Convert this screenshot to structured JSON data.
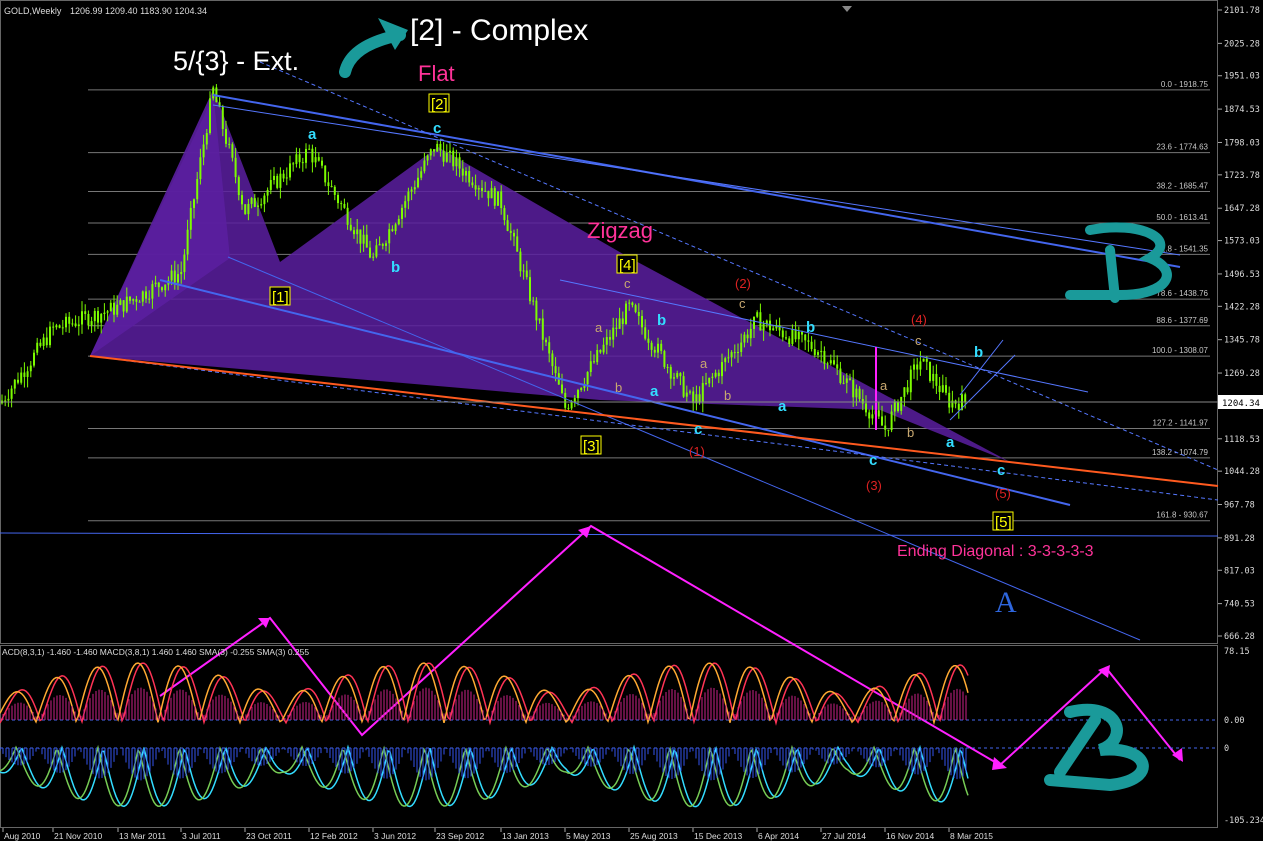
{
  "header": {
    "symbol": "GOLD,Weekly",
    "ohlc": "1206.99 1209.40 1183.90 1204.34"
  },
  "price_axis": {
    "labels": [
      "2101.78",
      "2025.28",
      "1951.03",
      "1874.53",
      "1798.03",
      "1723.78",
      "1647.28",
      "1573.03",
      "1496.53",
      "1422.28",
      "1345.78",
      "1269.28",
      "1204.34",
      "1118.53",
      "1044.28",
      "967.78",
      "891.28",
      "817.03",
      "740.53",
      "666.28"
    ],
    "current_price": "1204.34"
  },
  "macd_axis": {
    "labels": [
      "78.15",
      "0.00",
      "0",
      "-105.234"
    ]
  },
  "macd_header": "ACD(8,3,1) -1.460 -1.460  MACD(3,8,1) 1.460 1.460  SMA(3) -0.255  SMA(3) 0.255",
  "date_axis": [
    "Aug 2010",
    "21 Nov 2010",
    "13 Mar 2011",
    "3 Jul 2011",
    "23 Oct 2011",
    "12 Feb 2012",
    "3 Jun 2012",
    "23 Sep 2012",
    "13 Jan 2013",
    "5 May 2013",
    "25 Aug 2013",
    "15 Dec 2013",
    "6 Apr 2014",
    "27 Jul 2014",
    "16 Nov 2014",
    "8 Mar 2015"
  ],
  "fib_levels": [
    "0.0 - 1918.75",
    "23.6 - 1774.63",
    "38.2 - 1685.47",
    "50.0 - 1613.41",
    "61.8 - 1541.35",
    "78.6 - 1438.76",
    "88.6 - 1377.69",
    "100.0 - 1308.07",
    "127.2 - 1141.97",
    "138.2 - 1074.79",
    "161.8 - 930.67"
  ],
  "annotations": {
    "title_complex": "[2] - Complex",
    "ext": "5/{3} - Ext.",
    "flat": "Flat",
    "zigzag": "Zigzag",
    "ending_diagonal": "Ending Diagonal : 3-3-3-3-3",
    "big_a": "A",
    "w1": "[1]",
    "w2": "[2]",
    "w3": "[3]",
    "w4": "[4]",
    "w5": "[5]",
    "c2": "(2)",
    "c3": "(3)",
    "c4": "(4)",
    "c5": "(5)",
    "c1": "(1)",
    "a": "a",
    "b": "b",
    "c": "c"
  },
  "colors": {
    "background": "#000000",
    "candles": "#7CFC00",
    "wedge": "#5B1FA0",
    "trendline": "#5577FF",
    "orange_line": "#FF5A1F",
    "magenta": "#FF20FF",
    "pink_text": "#FF3399",
    "yellow": "#FFFF00",
    "cyan": "#33DDFF",
    "teal_icon": "#1A9A9A",
    "red_label": "#DD2222",
    "fib_text": "#C8C8C8"
  },
  "chart_data": {
    "type": "candlestick",
    "title": "GOLD,Weekly",
    "ylim": [
      666.28,
      2101.78
    ],
    "price_path": [
      {
        "date": "Aug 2010",
        "price": 1200
      },
      {
        "date": "21 Nov 2010",
        "price": 1370
      },
      {
        "date": "13 Mar 2011",
        "price": 1420
      },
      {
        "date": "3 Jul 2011",
        "price": 1500
      },
      {
        "date": "Sep 2011",
        "price": 1918.75
      },
      {
        "date": "23 Oct 2011",
        "price": 1640
      },
      {
        "date": "12 Feb 2012",
        "price": 1780
      },
      {
        "date": "3 Jun 2012",
        "price": 1530
      },
      {
        "date": "23 Sep 2012",
        "price": 1790
      },
      {
        "date": "13 Jan 2013",
        "price": 1660
      },
      {
        "date": "5 May 2013",
        "price": 1190
      },
      {
        "date": "25 Aug 2013",
        "price": 1420
      },
      {
        "date": "15 Dec 2013",
        "price": 1200
      },
      {
        "date": "6 Apr 2014",
        "price": 1390
      },
      {
        "date": "27 Jul 2014",
        "price": 1320
      },
      {
        "date": "16 Nov 2014",
        "price": 1140
      },
      {
        "date": "Jan 2015",
        "price": 1300
      },
      {
        "date": "8 Mar 2015",
        "price": 1204.34
      }
    ],
    "indicator": {
      "name": "MACD",
      "ylim": [
        -105.234,
        78.15
      ]
    }
  }
}
